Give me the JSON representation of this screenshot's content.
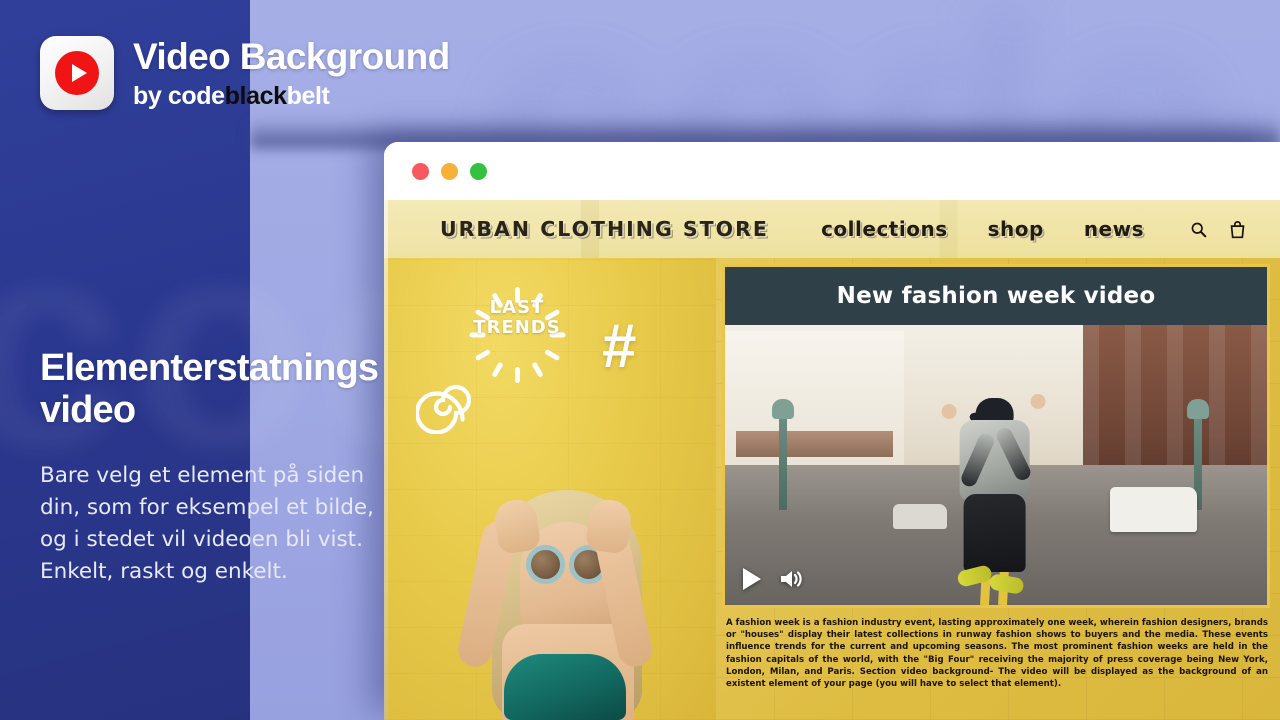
{
  "branding": {
    "icon_name": "video-play-app-icon",
    "title": "Video Background",
    "by_label": "by",
    "vendor_part1": "code",
    "vendor_part2": "black",
    "vendor_part3": "belt"
  },
  "promo": {
    "headline": "Elementerstatningsvideo",
    "body": "Bare velg et element på siden din, som for eksempel et bilde, og i stedet vil videoen bli vist. Enkelt, raskt og enkelt."
  },
  "browser": {
    "traffic_lights": [
      "close",
      "minimize",
      "maximize"
    ]
  },
  "site": {
    "brand": "URBAN CLOTHING STORE",
    "nav_links": [
      "collections",
      "shop",
      "news"
    ],
    "icons": [
      "search-icon",
      "shopping-bag-icon"
    ],
    "hero": {
      "badge_line1": "LAST",
      "badge_line2": "TRENDS",
      "hashtag": "#"
    },
    "video": {
      "title": "New fashion week video",
      "controls": [
        "play-icon",
        "volume-icon"
      ],
      "description": "A fashion week is a fashion industry event, lasting approximately one week, wherein fashion designers, brands or \"houses\" display their latest collections in runway fashion shows to buyers and the media. These events influence trends for the current and upcoming seasons. The most prominent fashion weeks are held in the fashion capitals of the world, with the \"Big Four\" receiving the majority of press coverage being New York, London, Milan, and Paris. Section video background- The video will be displayed as the background of an existent element of your page (you will have to select that element)."
    }
  },
  "colors": {
    "left_panel": "#2b3890",
    "right_panel": "#a3abe4",
    "accent_red": "#f01414",
    "site_nav": "#efe2a0",
    "site_body": "#e3c247",
    "video_header": "#2f4049",
    "video_border": "#e9c64a"
  },
  "ghost_text": "code"
}
